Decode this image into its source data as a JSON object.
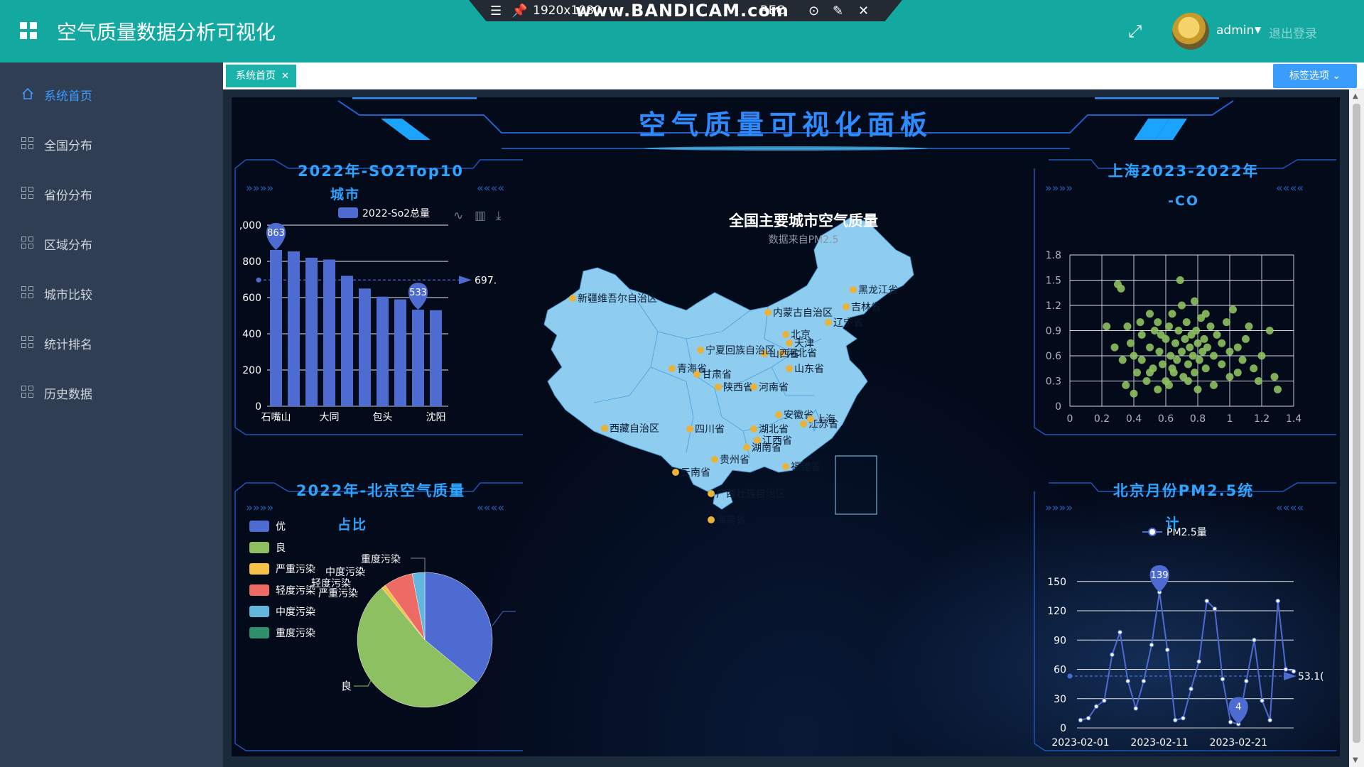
{
  "header": {
    "title": "空气质量数据分析可视化",
    "user": "admin",
    "logout": "退出登录"
  },
  "recorder": {
    "resolution": "1920x1080",
    "brand": "www.BANDICAM.com",
    "rec": "REC"
  },
  "sidebar": {
    "items": [
      {
        "label": "系统首页",
        "icon": "home-icon",
        "active": true
      },
      {
        "label": "全国分布",
        "icon": "grid-icon"
      },
      {
        "label": "省份分布",
        "icon": "grid-icon"
      },
      {
        "label": "区域分布",
        "icon": "grid-icon"
      },
      {
        "label": "城市比较",
        "icon": "grid-icon"
      },
      {
        "label": "统计排名",
        "icon": "grid-icon"
      },
      {
        "label": "历史数据",
        "icon": "grid-icon"
      }
    ]
  },
  "tabs": {
    "home": "系统首页",
    "options": "标签选项"
  },
  "dashboard": {
    "title": "空气质量可视化面板",
    "map": {
      "title": "全国主要城市空气质量",
      "subtitle": "数据来自PM2.5",
      "labels": [
        "新疆维吾尔自治区",
        "内蒙古自治区",
        "黑龙江省",
        "吉林省",
        "辽宁省",
        "北京",
        "天津",
        "河北省",
        "山西省",
        "宁夏回族自治区",
        "青海省",
        "甘肃省",
        "陕西省",
        "河南省",
        "山东省",
        "西藏自治区",
        "四川省",
        "湖北省",
        "安徽省",
        "江苏省",
        "上海",
        "湖南省",
        "江西省",
        "贵州省",
        "福建省",
        "云南省",
        "广西壮族自治区",
        "海南省"
      ],
      "colors": {
        "land": "#8ecdf0",
        "city_dot": "#e9b23a",
        "border": "#4aa0d8"
      }
    }
  },
  "charts": {
    "so2": {
      "title": "2022年-SO2Top10",
      "subtitle": "城市",
      "legend": "2022-So2总量",
      "markpoint_max": "863",
      "markpoint_min": "533",
      "avg_label": "697.",
      "ytick_top": ",000"
    },
    "pie": {
      "title": "2022年-北京空气质量",
      "subtitle": "占比",
      "label_good": "良"
    },
    "co": {
      "title": "上海2023-2022年",
      "subtitle": "-CO"
    },
    "pm25": {
      "title": "北京月份PM2.5统",
      "subtitle": "计",
      "legend": "PM2.5量",
      "markpoint_max": "139",
      "markpoint_min": "4",
      "avg_label": "53.1("
    }
  },
  "chart_data": [
    {
      "type": "bar",
      "title": "2022年-SO2Top10",
      "legend": [
        "2022-So2总量"
      ],
      "categories": [
        "石嘴山",
        "",
        "",
        "大同",
        "",
        "",
        "包头",
        "",
        "",
        "沈阳"
      ],
      "category_labels_shown": [
        "石嘴山",
        "大同",
        "包头",
        "沈阳"
      ],
      "values": [
        863,
        855,
        820,
        810,
        720,
        650,
        605,
        590,
        533,
        530
      ],
      "ylim": [
        0,
        1000
      ],
      "yticks": [
        "0",
        "200",
        "400",
        "600",
        "800",
        ",000"
      ],
      "color": "#4e6bd1",
      "markline_avg": 697
    },
    {
      "type": "pie",
      "title": "2022年-北京空气质量",
      "legend": [
        "优",
        "良",
        "严重污染",
        "轻度污染",
        "中度污染",
        "重度污染"
      ],
      "labels_shown": [
        "重度污染",
        "中度污染",
        "轻度污染",
        "严重污染",
        "良"
      ],
      "values": [
        36,
        53,
        1,
        7,
        3,
        0
      ],
      "colors": [
        "#4e6bd1",
        "#8dc060",
        "#f5c246",
        "#ee6a64",
        "#63b6de",
        "#2f8f6a"
      ]
    },
    {
      "type": "scatter",
      "title": "上海2023-2022年-CO",
      "xlim": [
        0,
        1.4
      ],
      "ylim": [
        0,
        1.8
      ],
      "xticks": [
        "0",
        "0.2",
        "0.4",
        "0.6",
        "0.8",
        "1",
        "1.2",
        "1.4"
      ],
      "yticks": [
        "0",
        "0.3",
        "0.6",
        "0.9",
        "1.2",
        "1.5",
        "1.8"
      ],
      "color": "#8dc060",
      "points": [
        [
          0.23,
          0.95
        ],
        [
          0.3,
          1.45
        ],
        [
          0.32,
          1.4
        ],
        [
          0.38,
          0.75
        ],
        [
          0.4,
          0.6
        ],
        [
          0.42,
          0.4
        ],
        [
          0.45,
          0.55
        ],
        [
          0.48,
          0.3
        ],
        [
          0.5,
          0.7
        ],
        [
          0.52,
          0.45
        ],
        [
          0.53,
          0.9
        ],
        [
          0.55,
          1.0
        ],
        [
          0.56,
          0.65
        ],
        [
          0.58,
          0.5
        ],
        [
          0.6,
          0.8
        ],
        [
          0.6,
          0.3
        ],
        [
          0.62,
          0.95
        ],
        [
          0.63,
          0.6
        ],
        [
          0.64,
          1.1
        ],
        [
          0.65,
          0.4
        ],
        [
          0.66,
          0.75
        ],
        [
          0.67,
          0.55
        ],
        [
          0.68,
          0.9
        ],
        [
          0.69,
          1.5
        ],
        [
          0.7,
          0.65
        ],
        [
          0.71,
          0.35
        ],
        [
          0.72,
          0.8
        ],
        [
          0.73,
          1.0
        ],
        [
          0.74,
          0.5
        ],
        [
          0.75,
          0.7
        ],
        [
          0.76,
          0.85
        ],
        [
          0.77,
          0.6
        ],
        [
          0.78,
          0.4
        ],
        [
          0.79,
          0.9
        ],
        [
          0.8,
          0.75
        ],
        [
          0.81,
          0.55
        ],
        [
          0.82,
          1.05
        ],
        [
          0.83,
          0.65
        ],
        [
          0.84,
          0.8
        ],
        [
          0.85,
          0.45
        ],
        [
          0.86,
          0.7
        ],
        [
          0.88,
          0.95
        ],
        [
          0.9,
          0.6
        ],
        [
          0.92,
          0.85
        ],
        [
          0.95,
          0.5
        ],
        [
          0.98,
          1.0
        ],
        [
          1.0,
          0.35
        ],
        [
          1.02,
          1.15
        ],
        [
          1.05,
          0.7
        ],
        [
          1.08,
          0.55
        ],
        [
          1.1,
          0.8
        ],
        [
          1.12,
          0.95
        ],
        [
          1.15,
          0.45
        ],
        [
          1.18,
          0.3
        ],
        [
          1.2,
          0.6
        ],
        [
          1.25,
          0.9
        ],
        [
          1.28,
          0.35
        ],
        [
          1.3,
          0.2
        ],
        [
          0.35,
          0.25
        ],
        [
          0.4,
          0.15
        ],
        [
          0.45,
          0.85
        ],
        [
          0.5,
          1.1
        ],
        [
          0.55,
          0.2
        ],
        [
          0.62,
          0.25
        ],
        [
          0.7,
          1.2
        ],
        [
          0.78,
          1.25
        ],
        [
          0.85,
          1.1
        ],
        [
          0.9,
          0.25
        ],
        [
          0.95,
          0.75
        ],
        [
          1.0,
          0.65
        ],
        [
          1.05,
          0.4
        ],
        [
          0.28,
          0.7
        ],
        [
          0.33,
          0.55
        ],
        [
          0.36,
          0.95
        ],
        [
          0.44,
          1.0
        ],
        [
          0.5,
          0.4
        ],
        [
          0.57,
          0.85
        ],
        [
          0.64,
          0.45
        ],
        [
          0.74,
          0.3
        ],
        [
          0.8,
          0.2
        ]
      ]
    },
    {
      "type": "line",
      "title": "北京月份PM2.5统计",
      "legend": [
        "PM2.5量"
      ],
      "x": [
        "2023-02-01",
        "2023-02-02",
        "2023-02-03",
        "2023-02-04",
        "2023-02-05",
        "2023-02-06",
        "2023-02-07",
        "2023-02-08",
        "2023-02-09",
        "2023-02-10",
        "2023-02-11",
        "2023-02-12",
        "2023-02-13",
        "2023-02-14",
        "2023-02-15",
        "2023-02-16",
        "2023-02-17",
        "2023-02-18",
        "2023-02-19",
        "2023-02-20",
        "2023-02-21",
        "2023-02-22",
        "2023-02-23",
        "2023-02-24",
        "2023-02-25",
        "2023-02-26",
        "2023-02-27",
        "2023-02-28"
      ],
      "xticks_shown": [
        "2023-02-01",
        "2023-02-11",
        "2023-02-21"
      ],
      "values": [
        8,
        10,
        22,
        28,
        75,
        98,
        48,
        20,
        48,
        85,
        139,
        80,
        8,
        10,
        40,
        68,
        130,
        122,
        50,
        6,
        4,
        48,
        90,
        28,
        8,
        130,
        60,
        58
      ],
      "ylim": [
        0,
        160
      ],
      "yticks": [
        "0",
        "30",
        "60",
        "90",
        "120",
        "150"
      ],
      "markpoint_max": 139,
      "markpoint_min": 4,
      "markline_avg": 53.1,
      "color": "#4e6bd1"
    }
  ]
}
